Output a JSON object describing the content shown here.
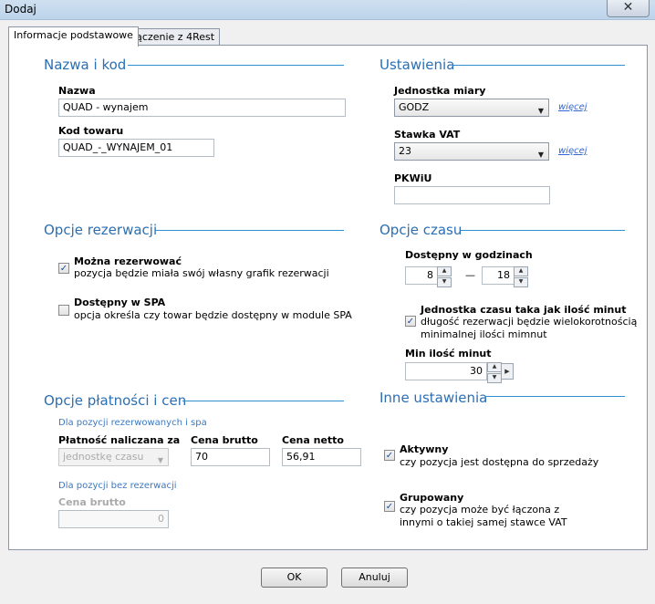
{
  "window": {
    "title": "Dodaj",
    "close_symbol": "✕"
  },
  "tabs": [
    {
      "label": "Informacje podstawowe"
    },
    {
      "label": "Łączenie z 4Rest"
    }
  ],
  "sections": {
    "nazwa": {
      "title": "Nazwa i kod",
      "name_label": "Nazwa",
      "name_value": "QUAD - wynajem",
      "code_label": "Kod towaru",
      "code_value": "QUAD_-_WYNAJEM_01"
    },
    "ustawienia": {
      "title": "Ustawienia",
      "unit_label": "Jednostka miary",
      "unit_value": "GODZ",
      "vat_label": "Stawka VAT",
      "vat_value": "23",
      "more_link": "więcej",
      "pkwiu_label": "PKWiU",
      "pkwiu_value": ""
    },
    "rezerwacja": {
      "title": "Opcje rezerwacji",
      "can_reserve": {
        "label": "Można rezerwować",
        "desc": "pozycja będzie miała swój własny grafik rezerwacji",
        "checked": true
      },
      "spa": {
        "label": "Dostępny w SPA",
        "desc": "opcja określa czy towar będzie dostępny w module SPA",
        "checked": false
      }
    },
    "czas": {
      "title": "Opcje czasu",
      "hours_label": "Dostępny w godzinach",
      "hour_from": "8",
      "dash": "—",
      "hour_to": "18",
      "unit_minutes": {
        "label": "Jednostka czasu taka jak ilość minut",
        "desc1": "długość rezerwacji będzie wielokorotnością",
        "desc2": "minimalnej ilości mimnut",
        "checked": true
      },
      "min_label": "Min ilość minut",
      "min_value": "30"
    },
    "platnosci": {
      "title": "Opcje płatności i cen",
      "reserved_caption": "Dla pozycji rezerwowanych i spa",
      "charged_label": "Płatność naliczana za",
      "charged_value": "jednostkę czasu",
      "gross_label": "Cena brutto",
      "gross_value": "70",
      "net_label": "Cena netto",
      "net_value": "56,91",
      "nonreserved_caption": "Dla pozycji bez rezerwacji",
      "gross2_label": "Cena brutto",
      "gross2_value": "0"
    },
    "inne": {
      "title": "Inne ustawienia",
      "active": {
        "label": "Aktywny",
        "desc": "czy pozycja jest dostępna do sprzedaży",
        "checked": true
      },
      "grouped": {
        "label": "Grupowany",
        "desc1": "czy pozycja może być łączona z",
        "desc2": "innymi o takiej samej stawce VAT",
        "checked": true
      }
    }
  },
  "buttons": {
    "ok": "OK",
    "cancel": "Anuluj"
  },
  "symbols": {
    "check": "✓",
    "dropdown": "▼",
    "up": "▲",
    "down": "▼",
    "left": "◀",
    "right": "▶"
  },
  "colors": {
    "section_title": "#2a6fb4",
    "link": "#3366cc",
    "caption": "#3b78c0"
  }
}
